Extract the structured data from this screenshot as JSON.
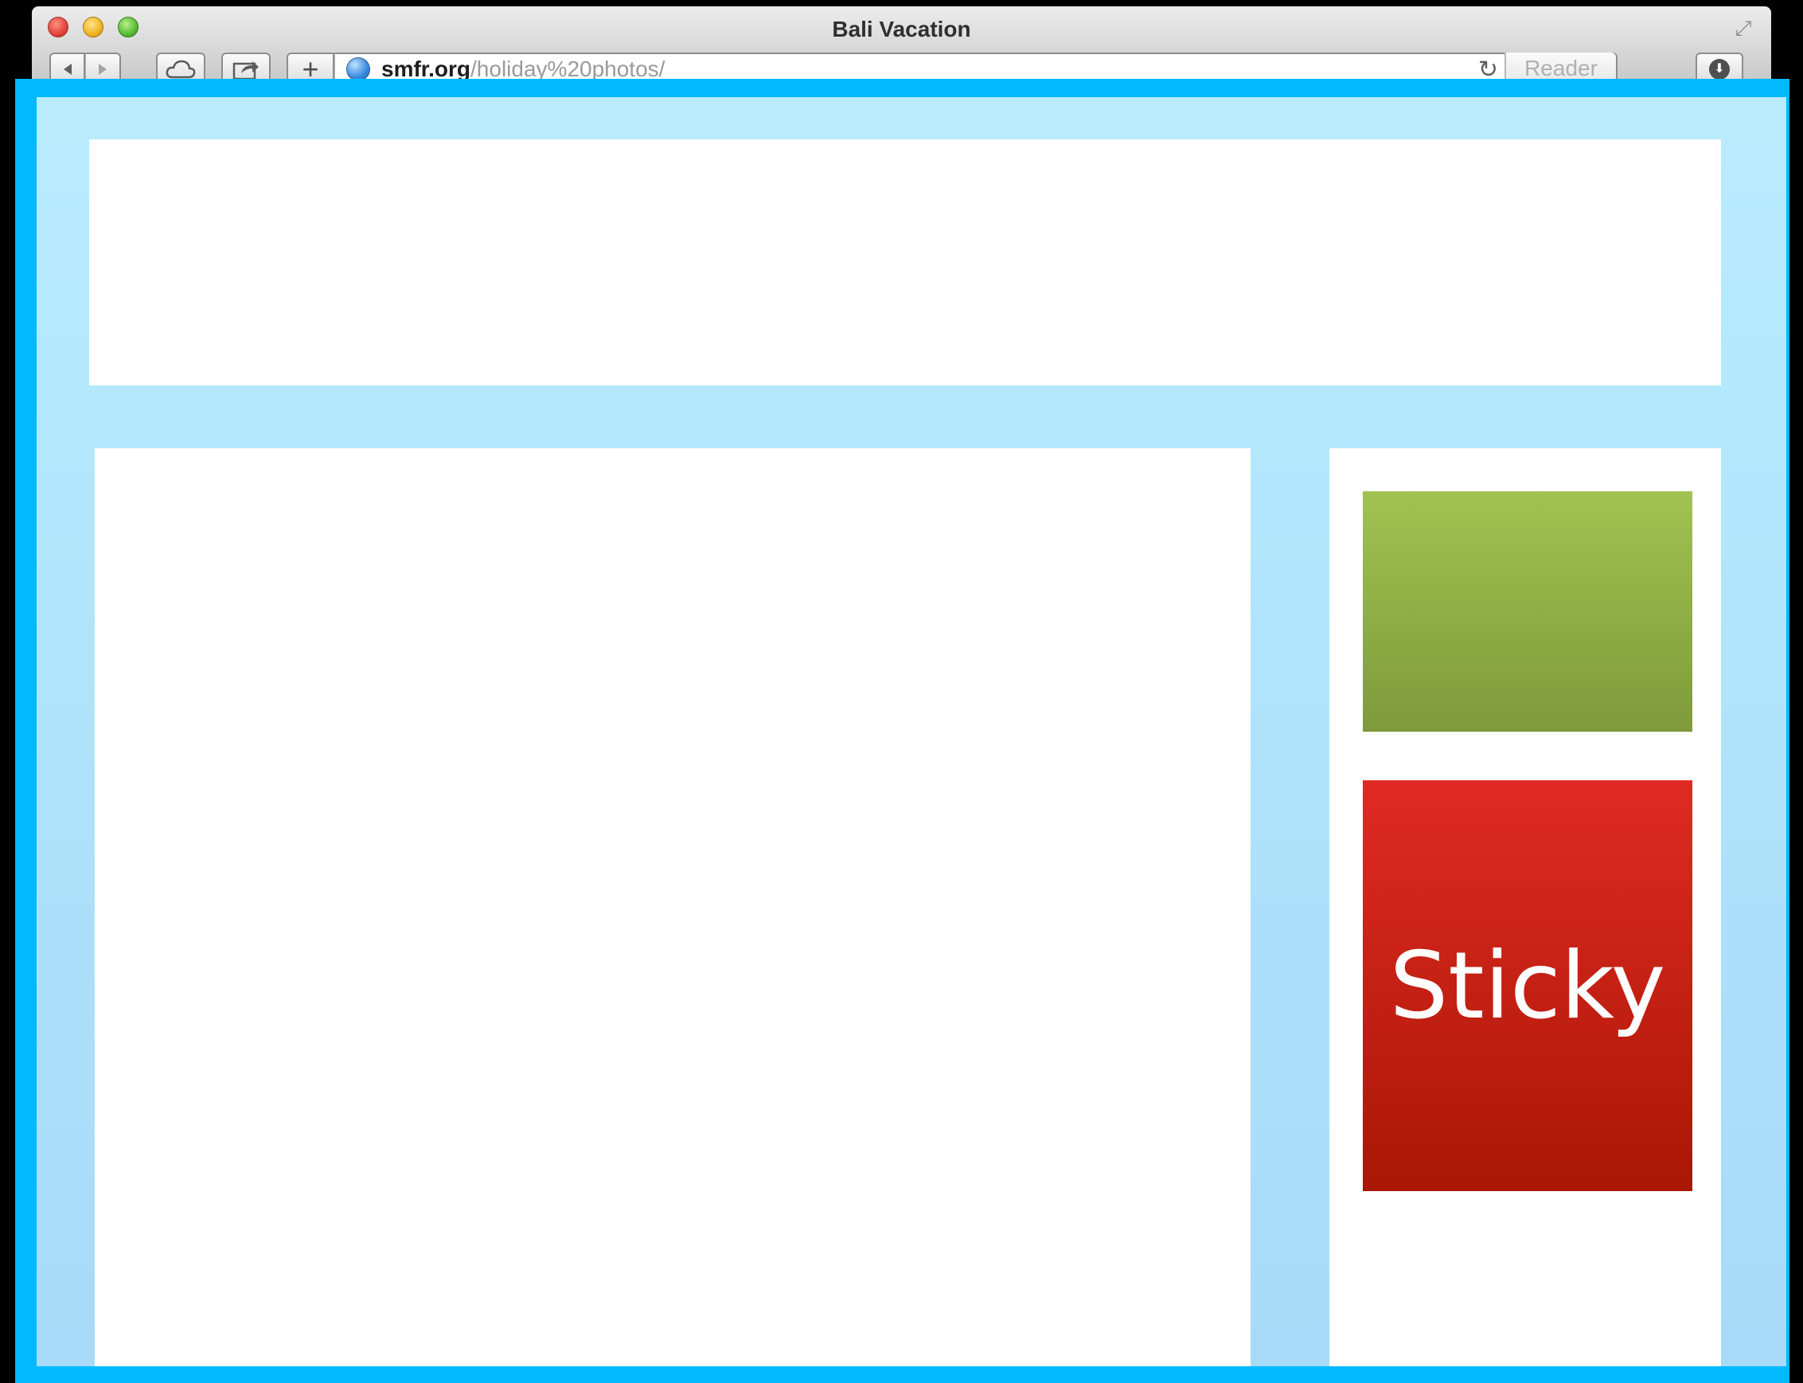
{
  "window": {
    "title": "Bali Vacation"
  },
  "toolbar": {
    "back_icon": "back-arrow-icon",
    "forward_icon": "forward-arrow-icon",
    "cloud_icon": "icloud-tabs-icon",
    "share_icon": "share-icon",
    "add_icon": "plus-icon",
    "add_label": "+",
    "reader_label": "Reader",
    "download_icon": "downloads-icon"
  },
  "address_bar": {
    "domain": "smfr.org",
    "path": "/holiday%20photos/"
  },
  "page": {
    "sticky_label": "Sticky",
    "colors": {
      "frame": "#00b9ff",
      "background": "#b8ecfd",
      "green_box": "#8fae45",
      "sticky_box": "#c81f16"
    }
  }
}
